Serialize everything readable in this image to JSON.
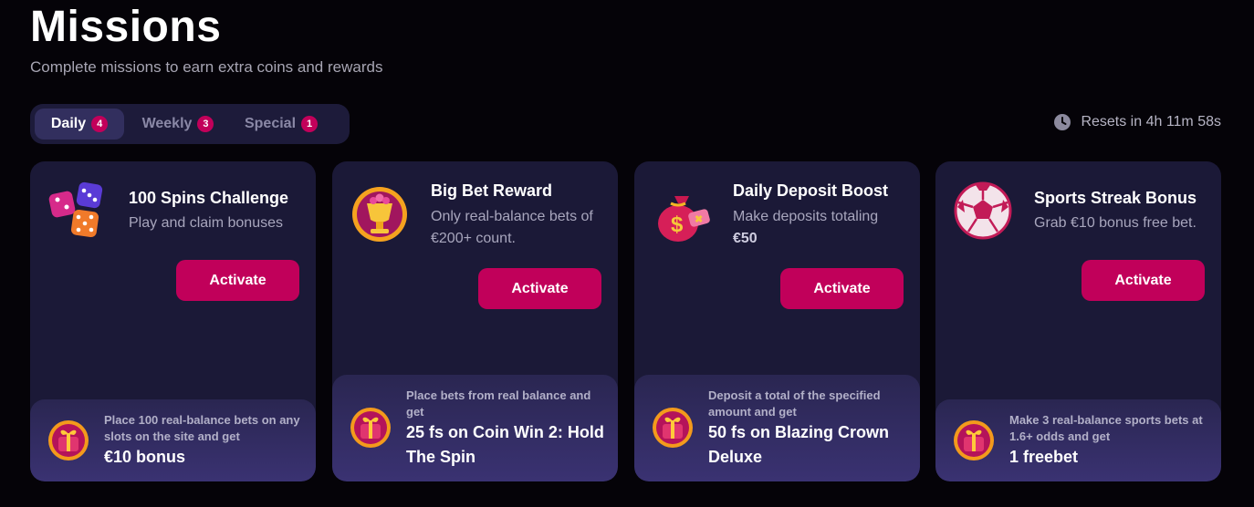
{
  "header": {
    "title": "Missions",
    "subtitle": "Complete missions to earn extra coins and rewards"
  },
  "tabs": [
    {
      "label": "Daily",
      "count": "4",
      "active": true
    },
    {
      "label": "Weekly",
      "count": "3",
      "active": false
    },
    {
      "label": "Special",
      "count": "1",
      "active": false
    }
  ],
  "reset": {
    "icon": "clock-icon",
    "text": "Resets in 4h 11m 58s"
  },
  "colors": {
    "accent": "#c1005a",
    "card_bg": "#1b1937",
    "page_bg": "#050308"
  },
  "missions": [
    {
      "icon": "dice-icon",
      "title": "100 Spins Challenge",
      "desc": "Play and claim bonuses",
      "desc_bold": "",
      "button": "Activate",
      "reward_icon": "gift-box-icon",
      "reward_desc": "Place 100 real-balance bets on any slots on the site and get",
      "reward": "€10 bonus"
    },
    {
      "icon": "trophy-cup-icon",
      "title": "Big Bet Reward",
      "desc": "Only real-balance bets of €200+ count.",
      "desc_bold": "",
      "button": "Activate",
      "reward_icon": "gift-box-icon",
      "reward_desc": "Place bets from real balance and get",
      "reward": "25 fs on Coin Win 2: Hold The Spin"
    },
    {
      "icon": "money-bag-icon",
      "title": "Daily Deposit Boost",
      "desc": "Make deposits totaling",
      "desc_bold": "€50",
      "button": "Activate",
      "reward_icon": "gift-box-icon",
      "reward_desc": "Deposit a total of the specified amount and get",
      "reward": "50 fs on Blazing Crown Deluxe"
    },
    {
      "icon": "soccer-ball-icon",
      "title": "Sports Streak Bonus",
      "desc": "Grab €10 bonus free bet.",
      "desc_bold": "",
      "button": "Activate",
      "reward_icon": "gift-box-icon",
      "reward_desc": "Make 3 real-balance sports bets at 1.6+ odds and get",
      "reward": "1 freebet"
    }
  ]
}
